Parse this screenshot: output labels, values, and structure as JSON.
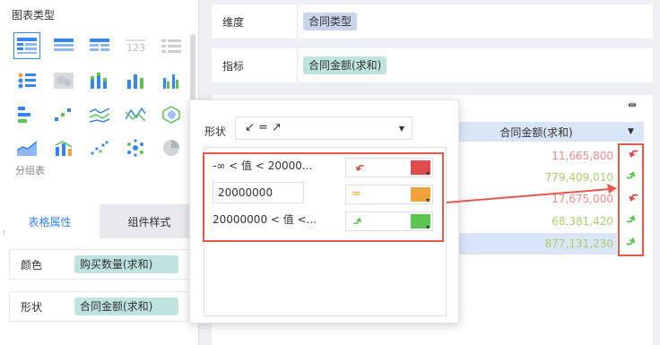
{
  "left_panel": {
    "chart_type_title": "图表类型",
    "group_label": "分组表",
    "tabs": [
      "表格属性",
      "组件样式"
    ],
    "properties": [
      {
        "label": "颜色",
        "field": "购买数量(求和)"
      },
      {
        "label": "形状",
        "field": "合同金额(求和)"
      }
    ]
  },
  "fields": {
    "dimension": {
      "label": "维度",
      "value": "合同类型"
    },
    "metric": {
      "label": "指标",
      "value": "合同金额(求和)"
    }
  },
  "table": {
    "column_header": "合同金额(求和)",
    "rows": [
      {
        "value": "11,665,800",
        "color": "#f08a8a",
        "shape": "down"
      },
      {
        "value": "779,409,010",
        "color": "#a9cf6f",
        "shape": "up"
      },
      {
        "value": "17,675,000",
        "color": "#f08a8a",
        "shape": "down"
      },
      {
        "value": "68,381,420",
        "color": "#a9cf6f",
        "shape": "up"
      },
      {
        "value": "877,131,230",
        "color": "#a9cf6f",
        "shape": "up"
      }
    ]
  },
  "popover": {
    "shape_label": "形状",
    "select_symbols": "↙ = ↗",
    "rules": [
      {
        "text": "-∞ < 值 < 20000...",
        "color": "#e04b4b",
        "icon": "red-down-arrow"
      },
      {
        "input": "20000000",
        "color": "#f2a23a",
        "icon": "orange-equal"
      },
      {
        "text": "20000000 < 值 <...",
        "color": "#5cc452",
        "icon": "green-up-arrow"
      }
    ]
  },
  "colors": {
    "accent": "#3685f2",
    "highlight": "#e5584b"
  }
}
